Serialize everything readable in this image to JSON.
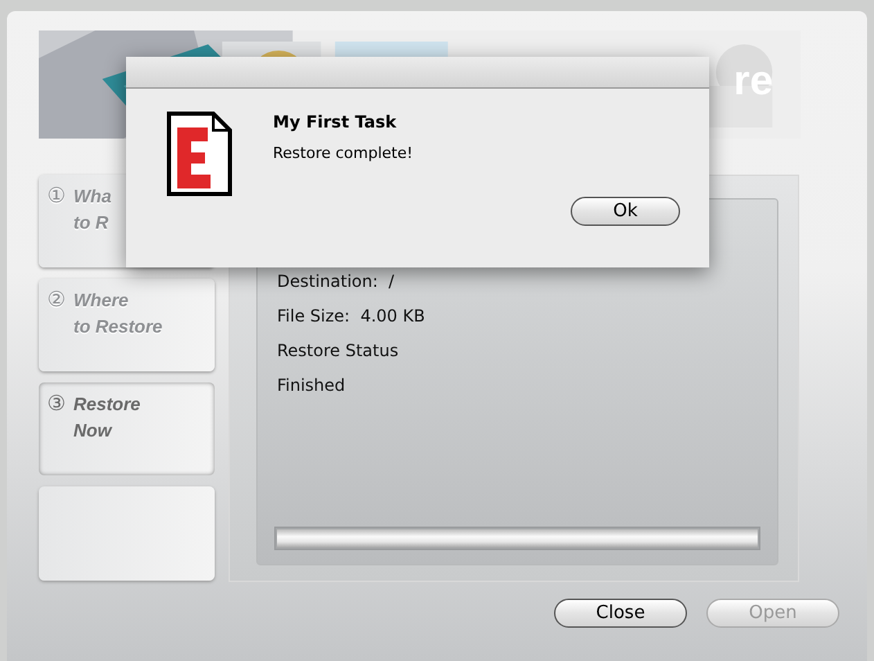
{
  "banner": {
    "title_fragment": "re"
  },
  "steps": [
    {
      "number": "①",
      "lines": [
        "Wha",
        "to R"
      ],
      "selected": false
    },
    {
      "number": "②",
      "lines": [
        "Where",
        "to Restore"
      ],
      "selected": false
    },
    {
      "number": "③",
      "lines": [
        "Restore",
        "Now"
      ],
      "selected": true
    }
  ],
  "details": [
    "Destination:  /",
    "File Size:  4.00 KB",
    "Restore Status",
    "Finished"
  ],
  "progress": {
    "level": 1
  },
  "buttons": [
    {
      "label": "Close",
      "disabled": false
    },
    {
      "label": "Open",
      "disabled": true
    }
  ],
  "dialog": {
    "title": "My First Task",
    "message": "Restore complete!",
    "button": "Ok"
  }
}
